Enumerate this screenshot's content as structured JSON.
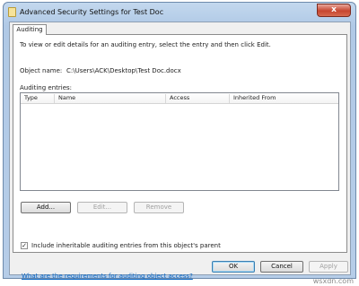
{
  "window": {
    "title": "Advanced Security Settings for Test Doc",
    "close_glyph": "x"
  },
  "tabs": [
    {
      "label": "Auditing"
    }
  ],
  "auditing": {
    "instructions": "To view or edit details for an auditing entry, select the entry and then click Edit.",
    "object_name_label": "Object name:",
    "object_name_value": "C:\\Users\\ACK\\Desktop\\Test Doc.docx",
    "entries_label": "Auditing entries:",
    "columns": [
      "Type",
      "Name",
      "Access",
      "Inherited From"
    ],
    "rows": [],
    "add_label": "Add...",
    "edit_label": "Edit...",
    "remove_label": "Remove",
    "inherit_checked": true,
    "inherit_label": "Include inheritable auditing entries from this object's parent",
    "inherit_checkmark": "✓",
    "help_link": "What are the requirements for auditing object access?"
  },
  "footer": {
    "ok_label": "OK",
    "cancel_label": "Cancel",
    "apply_label": "Apply"
  },
  "watermark": "wsxdn.com"
}
